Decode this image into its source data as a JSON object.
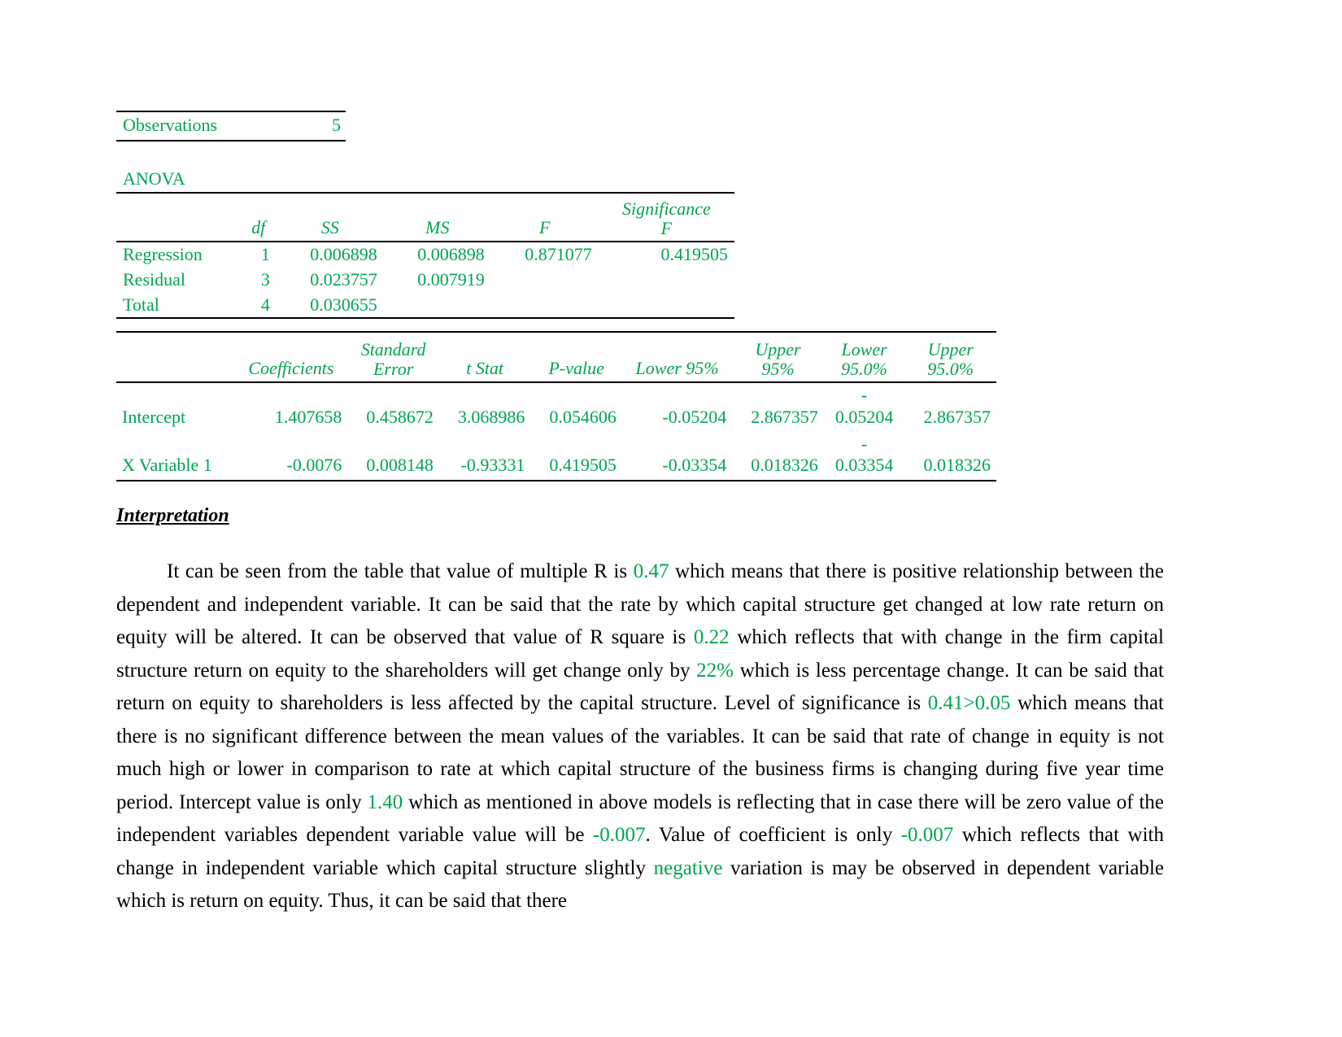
{
  "colors": {
    "accent_green": "#00A550",
    "text": "#000000",
    "rule": "#000000"
  },
  "observations": {
    "label": "Observations",
    "value": "5"
  },
  "anova": {
    "caption": "ANOVA",
    "headers": [
      "",
      "df",
      "SS",
      "MS",
      "F",
      "Significance",
      "F"
    ],
    "header_labels": {
      "df": "df",
      "ss": "SS",
      "ms": "MS",
      "f": "F",
      "sig_f_line1": "Significance",
      "sig_f_line2": "F"
    },
    "rows": [
      {
        "label": "Regression",
        "df": "1",
        "ss": "0.006898",
        "ms": "0.006898",
        "f": "0.871077",
        "sig_f": "0.419505"
      },
      {
        "label": "Residual",
        "df": "3",
        "ss": "0.023757",
        "ms": "0.007919",
        "f": "",
        "sig_f": ""
      },
      {
        "label": "Total",
        "df": "4",
        "ss": "0.030655",
        "ms": "",
        "f": "",
        "sig_f": ""
      }
    ]
  },
  "coefficients": {
    "header_labels": {
      "coefficients": "Coefficients",
      "std_err_line1": "Standard",
      "std_err_line2": "Error",
      "t_stat": "t Stat",
      "p_value": "P-value",
      "lower95": "Lower 95%",
      "upper95_line1": "Upper",
      "upper95_line2": "95%",
      "lower95_0_line1": "Lower",
      "lower95_0_line2": "95.0%",
      "upper95_0_line1": "Upper",
      "upper95_0_line2": "95.0%"
    },
    "rows": [
      {
        "label": "Intercept",
        "coefficient": "1.407658",
        "standard_error": "0.458672",
        "t_stat": "3.068986",
        "p_value": "0.054606",
        "lower95": "-0.05204",
        "upper95": "2.867357",
        "lower95_0_minus": "-",
        "lower95_0": "0.05204",
        "upper95_0": "2.867357"
      },
      {
        "label": "X Variable 1",
        "coefficient": "-0.0076",
        "standard_error": "0.008148",
        "t_stat": "-0.93331",
        "p_value": "0.419505",
        "lower95": "-0.03354",
        "upper95": "0.018326",
        "lower95_0_minus": "-",
        "lower95_0": "0.03354",
        "upper95_0": "0.018326"
      }
    ]
  },
  "interpretation": {
    "heading": "Interpretation",
    "paragraph": {
      "p1": "It can be seen from the table that value of multiple R is ",
      "v1": "0.47",
      "p2": " which means that there is positive relationship between the dependent and independent variable. It can be said that the rate by which capital structure get changed at low rate return on equity will be altered. It can be observed that value of R square is ",
      "v2": "0.22",
      "p3": " which reflects that with change in the firm capital structure return on equity to the shareholders will get change only by ",
      "v3": "22%",
      "p4": " which is less percentage change. It can be said that return on equity to shareholders is less affected by the capital structure. Level of significance is ",
      "v4": "0.41>0.05",
      "p5": " which means that there is no significant difference between the mean values of the variables. It can be said that rate of change in equity is not much high or lower in comparison to rate at which capital structure of the business firms is changing during five year time period. Intercept value is only ",
      "v5": "1.40",
      "p6": " which as mentioned in above models is reflecting that in case there will be zero value of the independent variables dependent variable value will be ",
      "v6": "-0.007",
      "p7": ". Value of coefficient is only ",
      "v7": "-0.007",
      "p8": " which reflects that with change in independent variable which capital structure slightly ",
      "v8": "negative",
      "p9": " variation is may be observed in dependent variable which is return on equity. Thus, it can be said that there"
    }
  }
}
